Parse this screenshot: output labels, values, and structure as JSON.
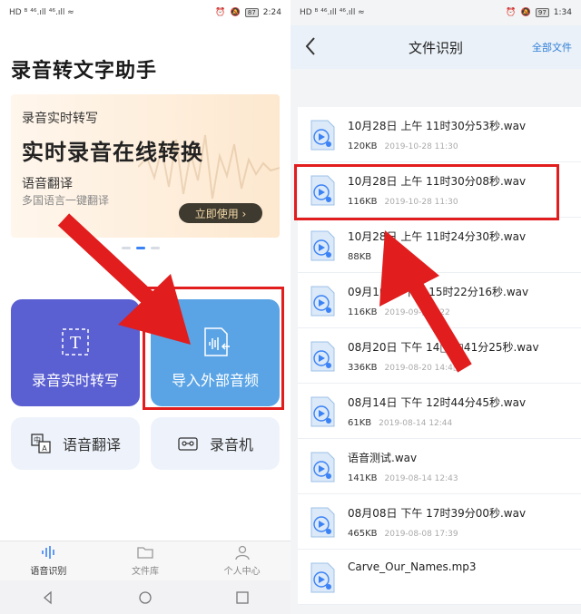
{
  "left": {
    "status": {
      "left": "HD ᴮ ⁴⁶.ıll ⁴⁶.ıll ≈",
      "time": "2:24",
      "battery": "87"
    },
    "app_title": "录音转文字助手",
    "banner": {
      "small": "录音实时转写",
      "big": "实时录音在线转换",
      "sub": "语音翻译",
      "sub2": "多国语言一键翻译",
      "button": "立即使用 ›"
    },
    "cards": {
      "realtime": "录音实时转写",
      "import": "导入外部音频",
      "translate": "语音翻译",
      "recorder": "录音机"
    },
    "tabs": [
      {
        "label": "语音识别",
        "icon": "waveform-icon"
      },
      {
        "label": "文件库",
        "icon": "folder-icon"
      },
      {
        "label": "个人中心",
        "icon": "person-icon"
      }
    ]
  },
  "right": {
    "status": {
      "left": "HD ᴮ ⁴⁶.ıll ⁴⁶.ıll ≈",
      "time": "1:34",
      "battery": "97"
    },
    "header": {
      "title": "文件识别",
      "action": "全部文件"
    },
    "files": [
      {
        "name": "10月28日 上午 11时30分53秒.wav",
        "size": "120KB",
        "date": "2019-10-28 11:30"
      },
      {
        "name": "10月28日 上午 11时30分08秒.wav",
        "size": "116KB",
        "date": "2019-10-28 11:30"
      },
      {
        "name": "10月28日 上午 11时24分30秒.wav",
        "size": "88KB",
        "date": ""
      },
      {
        "name": "09月1□日 下□ 15时22分16秒.wav",
        "size": "116KB",
        "date": "2019-09-□ □22"
      },
      {
        "name": "08月20日 下午 14□ □41分25秒.wav",
        "size": "336KB",
        "date": "2019-08-20 14:4□"
      },
      {
        "name": "08月14日 下午 12时44分45秒.wav",
        "size": "61KB",
        "date": "2019-08-14 12:44"
      },
      {
        "name": "语音测试.wav",
        "size": "141KB",
        "date": "2019-08-14 12:43"
      },
      {
        "name": "08月08日 下午 17时39分00秒.wav",
        "size": "465KB",
        "date": "2019-08-08 17:39"
      },
      {
        "name": "Carve_Our_Names.mp3",
        "size": "",
        "date": ""
      }
    ]
  },
  "colors": {
    "highlight": "#e11d1d",
    "arrow": "#e11d1d",
    "accent": "#3b82f6",
    "card_purple": "#5a5fd1",
    "card_blue": "#5aa4e6"
  }
}
